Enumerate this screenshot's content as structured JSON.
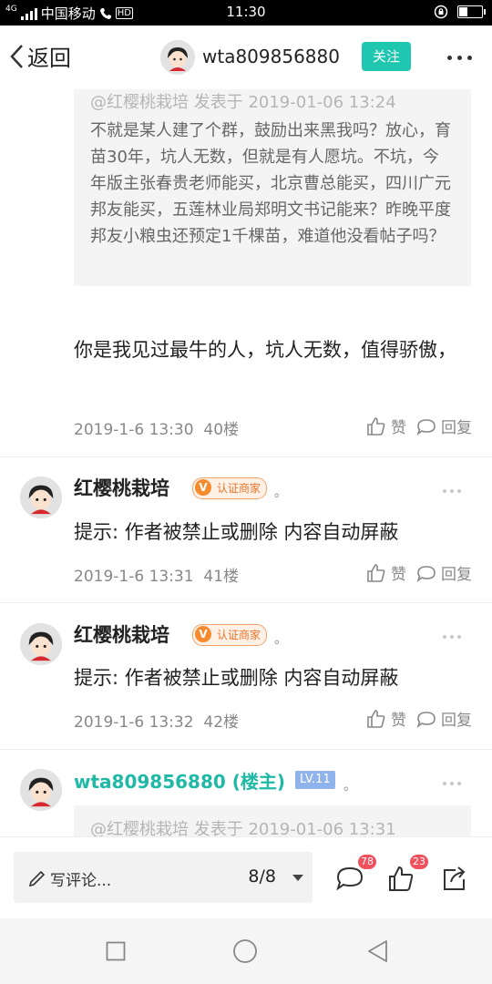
{
  "status_bar": {
    "network": "4G",
    "carrier": "中国移动",
    "hd": "HD",
    "time": "11:30"
  },
  "header": {
    "back_label": "返回",
    "username": "wta809856880",
    "follow_label": "关注"
  },
  "posts": [
    {
      "quote_meta": "@红樱桃栽培 发表于 2019-01-06 13:24",
      "quote_text": "不就是某人建了个群，鼓励出来黑我吗？放心，育苗30年，坑人无数，但就是有人愿坑。不坑，今年版主张春贵老师能买，北京曹总能买，四川广元邦友能买，五莲林业局郑明文书记能来？昨晚平度邦友小粮虫还预定1千棵苗，难道他没看帖子吗？",
      "text": "你是我见过最牛的人，坑人无数，值得骄傲，",
      "date": "2019-1-6 13:30",
      "floor": "40楼"
    },
    {
      "author": "红樱桃栽培",
      "badge": "认证商家",
      "badge_v": "V",
      "dot": "。",
      "text": "提示: 作者被禁止或删除 内容自动屏蔽",
      "date": "2019-1-6 13:31",
      "floor": "41楼"
    },
    {
      "author": "红樱桃栽培",
      "badge": "认证商家",
      "badge_v": "V",
      "dot": "。",
      "text": "提示: 作者被禁止或删除 内容自动屏蔽",
      "date": "2019-1-6 13:32",
      "floor": "42楼"
    },
    {
      "author": "wta809856880 (楼主)",
      "level": "LV.11",
      "dot": "。",
      "quote_meta": "@红樱桃栽培 发表于 2019-01-06 13:31"
    }
  ],
  "actions": {
    "like_label": "赞",
    "reply_label": "回复"
  },
  "bottom_bar": {
    "comment_placeholder": "写评论...",
    "page_indicator": "8/8",
    "comment_count": "78",
    "like_count": "23"
  },
  "colors": {
    "accent": "#1fc6b0",
    "badge": "#f58b2e",
    "count": "#f0515e"
  }
}
